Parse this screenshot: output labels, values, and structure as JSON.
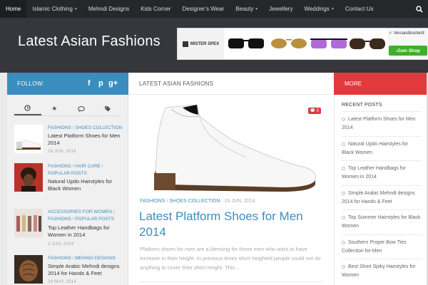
{
  "nav": {
    "items": [
      {
        "label": "Home",
        "active": true,
        "caret": false
      },
      {
        "label": "Islamic Clothing",
        "active": false,
        "caret": true
      },
      {
        "label": "Mehndi Designs",
        "active": false,
        "caret": false
      },
      {
        "label": "Kids Corner",
        "active": false,
        "caret": false
      },
      {
        "label": "Designer's Wear",
        "active": false,
        "caret": false
      },
      {
        "label": "Beauty",
        "active": false,
        "caret": true
      },
      {
        "label": "Jewellery",
        "active": false,
        "caret": false
      },
      {
        "label": "Weddings",
        "active": false,
        "caret": true
      },
      {
        "label": "Contact Us",
        "active": false,
        "caret": false
      }
    ],
    "search_icon": "search-icon"
  },
  "header": {
    "site_title": "Latest Asian Fashions",
    "ad": {
      "brand": "MISTER SPEX",
      "check_text": "Versandkostenfr",
      "button": "Zum Shop"
    }
  },
  "sidebar_left": {
    "follow_label": "FOLLOW:",
    "social": [
      "f",
      "p",
      "g+"
    ],
    "tabs": [
      "clock-icon",
      "star-icon",
      "comments-icon",
      "tags-icon"
    ],
    "posts": [
      {
        "meta": [
          "FASHIONS",
          "SHOES COLLECTION"
        ],
        "title": "Latest Platform Shoes for Men 2014",
        "date": "16 JUN, 2014"
      },
      {
        "meta": [
          "FASHIONS",
          "HAIR CARE",
          "POPULAR POSTS"
        ],
        "title": "Natural Updo Hairstyles for Black Women",
        "date": ""
      },
      {
        "meta": [
          "ACCESSORIES FOR WOMEN",
          "FASHIONS",
          "POPULAR POSTS"
        ],
        "title": "Top Leather Handbags for Women in 2014",
        "date": "2 JUN, 2014"
      },
      {
        "meta": [
          "FASHIONS",
          "MEHNDI DESIGNS"
        ],
        "title": "Simple Arabic Mehndi designs 2014 for Hands & Feet",
        "date": "29 MAY, 2014"
      }
    ]
  },
  "main": {
    "section_title": "LATEST ASIAN FASHIONS",
    "comment_count": "0",
    "meta_cat1": "FASHIONS",
    "meta_cat2": "SHOES COLLECTION",
    "meta_date": "16 JUN, 2014",
    "title": "Latest Platform Shoes for Men 2014",
    "excerpt": "Platform shoes for men are a blessing for those men who want to have increase in their height. In previous times short heighted people could not do anything to cover their short height. This..."
  },
  "sidebar_right": {
    "more_label": "MORE",
    "recent_heading": "RECENT POSTS",
    "recent_posts": [
      "Latest Platform Shoes for Men 2014",
      "Natural Updo Hairstyles for Black Women",
      "Top Leather Handbags for Women in 2014",
      "Simple Arabic Mehndi designs 2014 for Hands & Feet",
      "Top Summer Hairstyles for Black Women",
      "Southern Proper Bow Ties Collection for Men",
      "Best Short Spiky Hairstyles for Women"
    ]
  },
  "colors": {
    "accent_blue": "#3b8dbd",
    "accent_red": "#e3393c",
    "nav_bg": "#26272b",
    "header_bg": "#35373d"
  }
}
